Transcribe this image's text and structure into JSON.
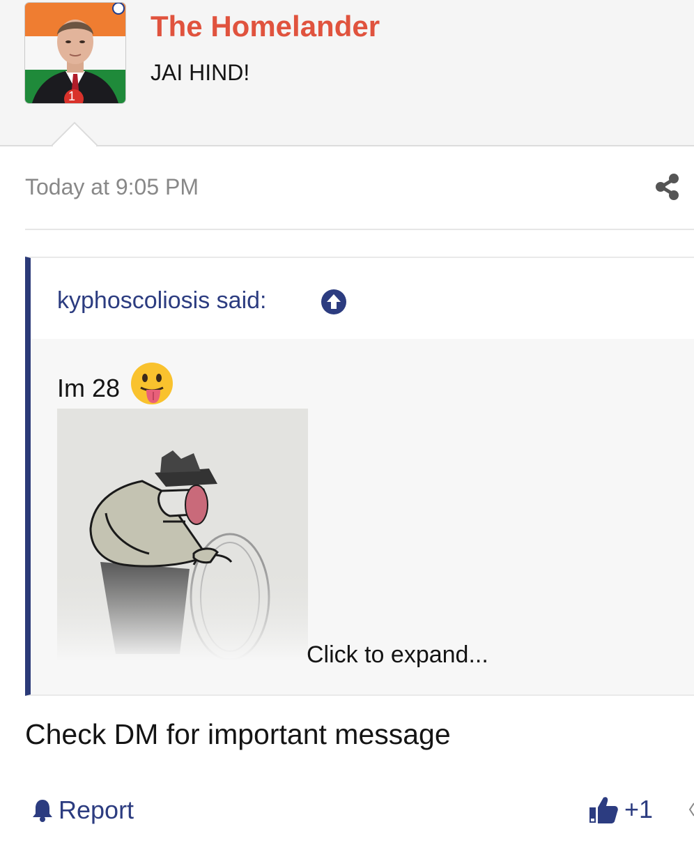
{
  "post": {
    "author": {
      "name": "The Homelander",
      "title": "JAI HIND!",
      "avatar_badge": "1"
    },
    "timestamp": "Today at 9:05 PM",
    "quote": {
      "author_label": "kyphoscoliosis said:",
      "text": "Im 28",
      "expand_label": "Click to expand..."
    },
    "message": "Check DM for important message",
    "actions": {
      "report_label": "Report",
      "like_count": "+1"
    }
  },
  "icons": {
    "share": "share-icon",
    "quote_jump": "arrow-up-circle-icon",
    "emoji": "face-with-tongue-emoji",
    "report": "bell-icon",
    "like": "thumbs-up-icon"
  },
  "colors": {
    "author_name": "#e0533e",
    "link": "#2c3c80",
    "quote_border": "#2b3a78",
    "timestamp": "#888888"
  }
}
